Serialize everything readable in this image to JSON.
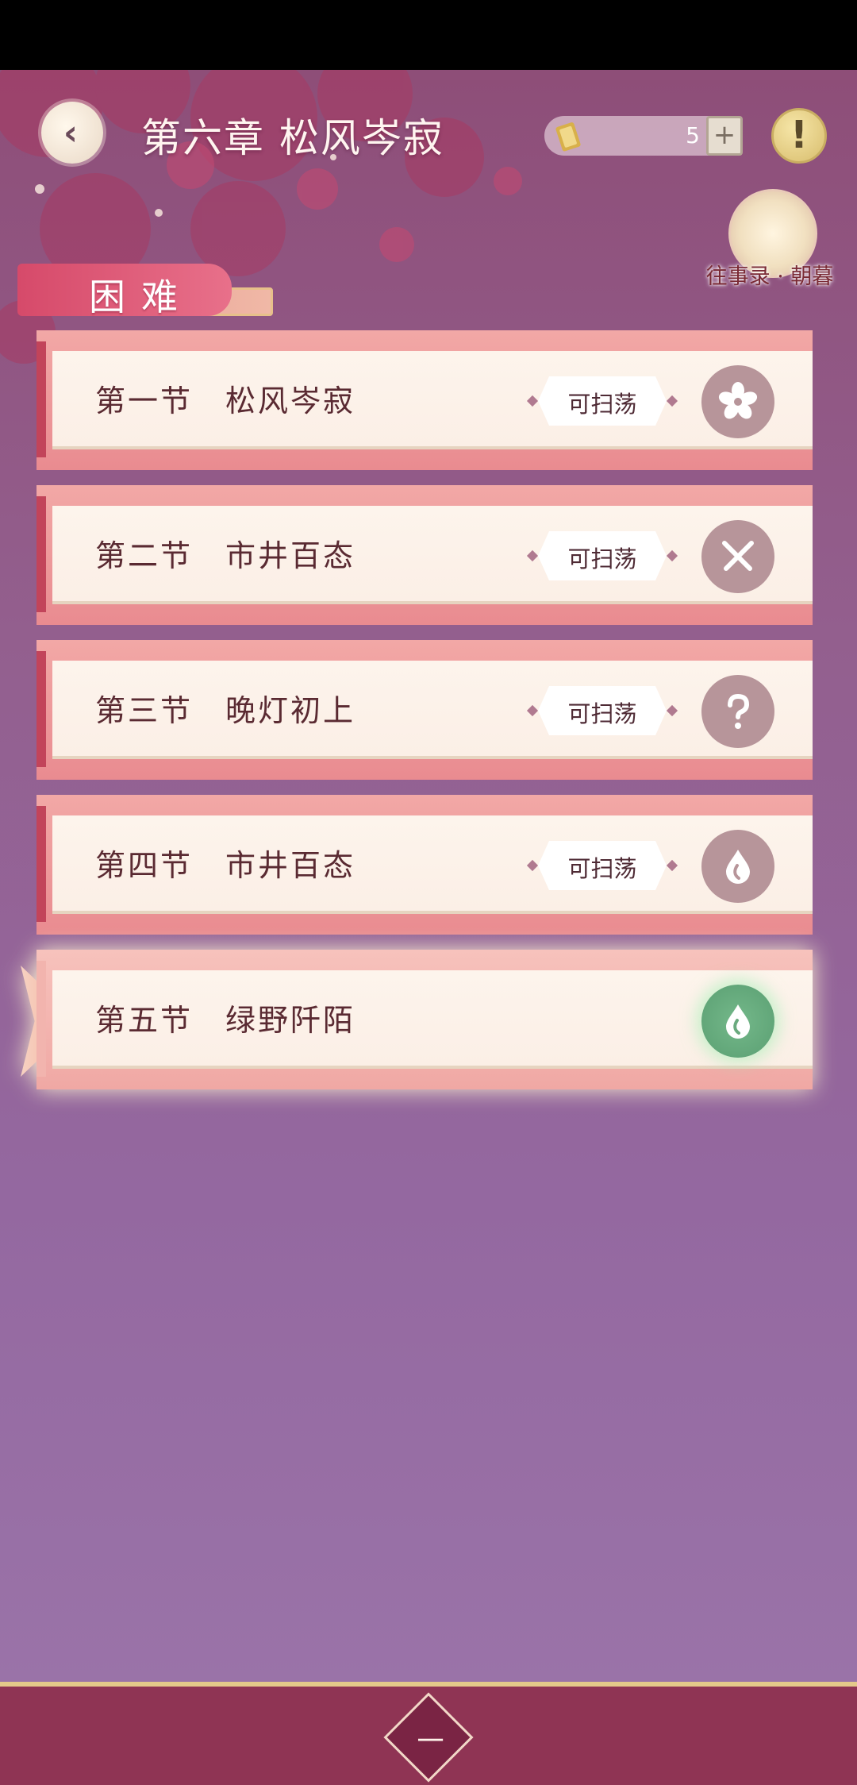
{
  "header": {
    "chapter_title": "第六章 松风岑寂",
    "ticket_count": "5",
    "ticket_plus": "+",
    "alert_symbol": "!",
    "memo_label": "往事录 · 朝暮"
  },
  "difficulty": {
    "label": "困难"
  },
  "sections": [
    {
      "number": "第一节",
      "name": "松风岑寂",
      "sweep_label": "可扫荡",
      "icon": "flower-icon"
    },
    {
      "number": "第二节",
      "name": "市井百态",
      "sweep_label": "可扫荡",
      "icon": "crossed-swords-icon"
    },
    {
      "number": "第三节",
      "name": "晚灯初上",
      "sweep_label": "可扫荡",
      "icon": "question-icon"
    },
    {
      "number": "第四节",
      "name": "市井百态",
      "sweep_label": "可扫荡",
      "icon": "water-drop-icon"
    },
    {
      "number": "第五节",
      "name": "绿野阡陌",
      "sweep_label": "",
      "icon": "water-drop-icon"
    }
  ],
  "bottom": {
    "chapter_selector": "一"
  },
  "colors": {
    "accent": "#d64a6a",
    "active_icon": "#6aaa7e",
    "inactive_icon": "#b7959a",
    "bottom_bar": "#8f3454"
  }
}
